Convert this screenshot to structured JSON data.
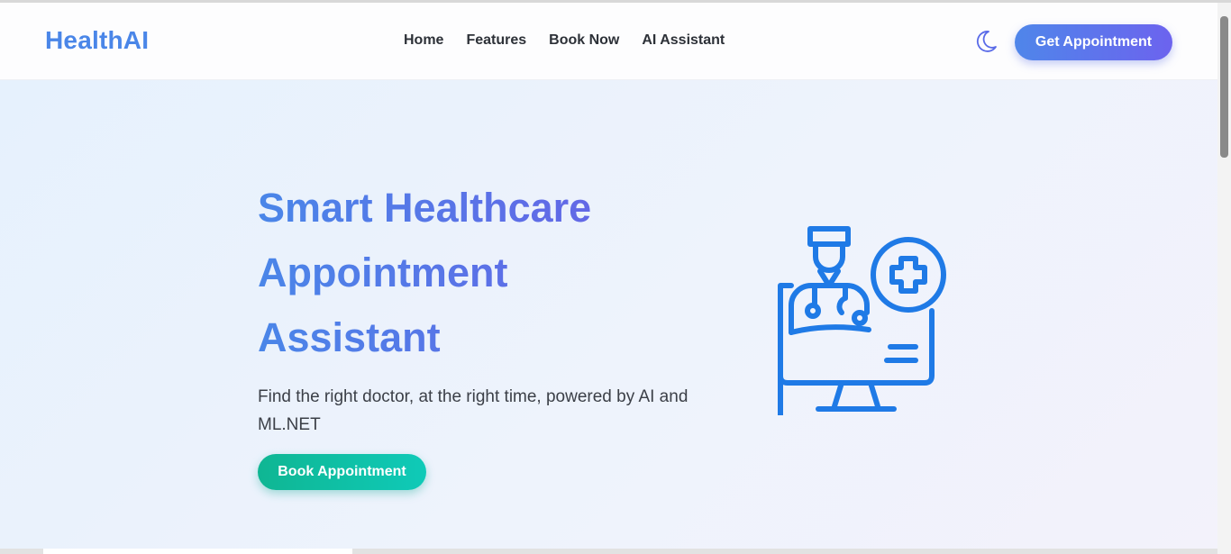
{
  "header": {
    "brand": "HealthAI",
    "nav": [
      "Home",
      "Features",
      "Book Now",
      "AI Assistant"
    ],
    "theme_toggle_icon": "moon-icon",
    "cta_label": "Get Appointment"
  },
  "hero": {
    "title_line1": "Smart Healthcare",
    "title_line2": "Appointment",
    "title_line3": "Assistant",
    "subtitle": "Find the right doctor, at the right time, powered by AI and ML.NET",
    "cta_label": "Book Appointment",
    "illustration_icon": "doctor-computer-icon"
  },
  "colors": {
    "brand": "#4a86e8",
    "accent_gradient_end": "#6a5fe6",
    "hero_cta": "#0fb693",
    "icon_blue": "#1f7ae6"
  }
}
